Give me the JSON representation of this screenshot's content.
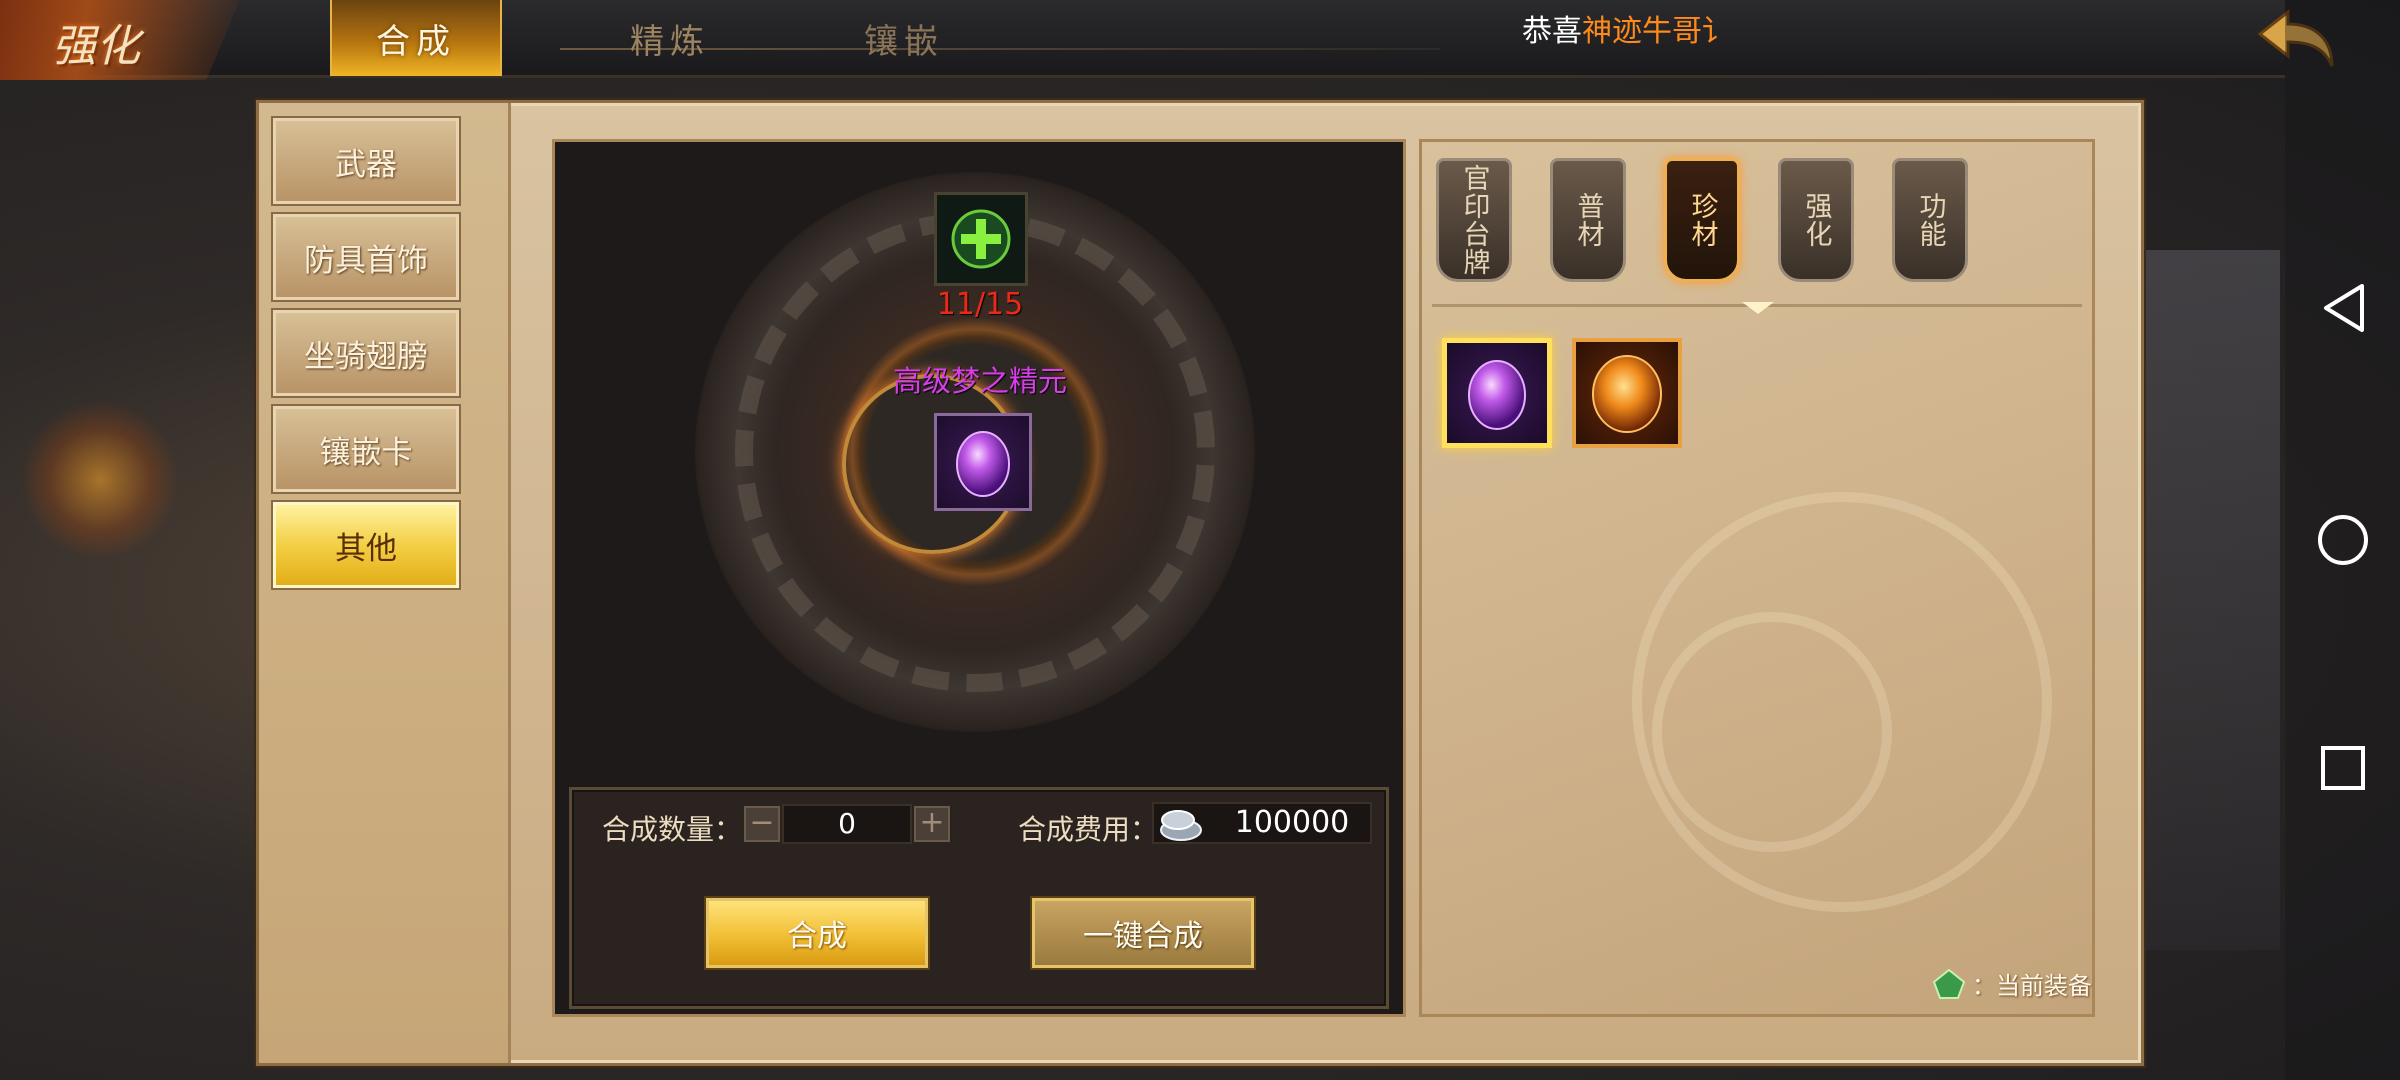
{
  "header": {
    "logo_text": "强化",
    "tabs": [
      {
        "label": "合成",
        "active": true
      },
      {
        "label": "精炼",
        "active": false
      },
      {
        "label": "镶嵌",
        "active": false
      }
    ],
    "announcement_prefix": "恭喜",
    "announcement_highlight": "神迹牛哥讠"
  },
  "categories": [
    {
      "label": "武器",
      "active": false
    },
    {
      "label": "防具首饰",
      "active": false
    },
    {
      "label": "坐骑翅膀",
      "active": false
    },
    {
      "label": "镶嵌卡",
      "active": false
    },
    {
      "label": "其他",
      "active": true
    }
  ],
  "synth": {
    "material_count": "11/15",
    "result_name": "高级梦之精元",
    "qty_label": "合成数量：",
    "qty_value": "0",
    "qty_minus": "−",
    "qty_plus": "+",
    "cost_label": "合成费用：",
    "cost_value": "100000",
    "synth_button": "合成",
    "one_click_button": "一键合成"
  },
  "sub_tabs": [
    {
      "label": "官印台牌",
      "active": false
    },
    {
      "label": "普材",
      "active": false
    },
    {
      "label": "珍材",
      "active": true
    },
    {
      "label": "强化",
      "active": false
    },
    {
      "label": "功能",
      "active": false
    }
  ],
  "inventory": [
    {
      "icon": "purple-gem-icon",
      "selected": true
    },
    {
      "icon": "orange-gem-icon",
      "selected": false
    }
  ],
  "legend_note": "：当前装备",
  "colors": {
    "accent_gold": "#f1bf34",
    "highlight_orange": "#ff8a1c",
    "count_red": "#ea2a18",
    "item_purple": "#d83ee8"
  }
}
